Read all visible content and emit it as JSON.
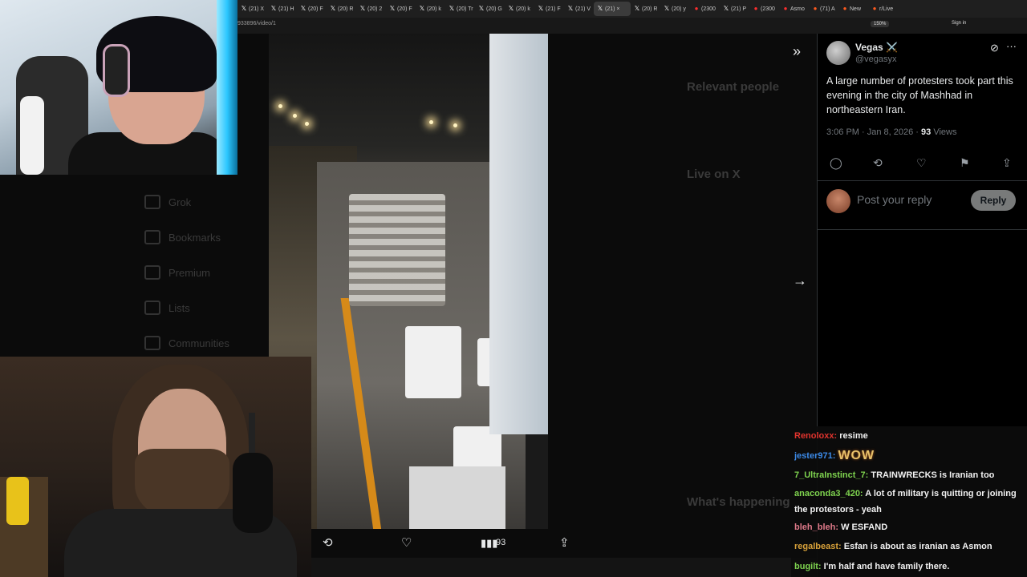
{
  "browser": {
    "tabs": [
      {
        "label": "(21) X",
        "favicon": "X"
      },
      {
        "label": "(21) H",
        "favicon": "X"
      },
      {
        "label": "(20) F",
        "favicon": "X"
      },
      {
        "label": "(20) R",
        "favicon": "X"
      },
      {
        "label": "(20) 2",
        "favicon": "X"
      },
      {
        "label": "(20) F",
        "favicon": "X"
      },
      {
        "label": "(20) k",
        "favicon": "X"
      },
      {
        "label": "(20) Tr",
        "favicon": "X"
      },
      {
        "label": "(20) G",
        "favicon": "X"
      },
      {
        "label": "(20) k",
        "favicon": "X"
      },
      {
        "label": "(21) F",
        "favicon": "X"
      },
      {
        "label": "(21) V",
        "favicon": "X"
      },
      {
        "label": "(21) ×",
        "favicon": "X",
        "active": true
      },
      {
        "label": "(20) R",
        "favicon": "X"
      },
      {
        "label": "(20) y",
        "favicon": "X"
      },
      {
        "label": "(2300",
        "favicon": "yt"
      },
      {
        "label": "(21) P",
        "favicon": "X"
      },
      {
        "label": "(2300",
        "favicon": "yt"
      },
      {
        "label": "Asmo",
        "favicon": "yt"
      },
      {
        "label": "(71) A",
        "favicon": "pi"
      },
      {
        "label": "New",
        "favicon": "rd"
      },
      {
        "label": "r/Live",
        "favicon": "rd"
      }
    ],
    "url": "933896/video/1",
    "zoom": "150%",
    "signin": "Sign in"
  },
  "background_page": {
    "nav": [
      "Grok",
      "Bookmarks",
      "Premium",
      "Lists",
      "Communities"
    ],
    "relevant_title": "Relevant people",
    "live_title": "Live on X",
    "happening_title": "What's happening"
  },
  "media": {
    "views": "93"
  },
  "tweet": {
    "name": "Vegas ⚔️",
    "handle": "@vegasyx",
    "text": "A large number of protesters took part this evening in the city of Mashhad in northeastern Iran.",
    "time": "3:06 PM · Jan 8, 2026 ·",
    "views_count": "93",
    "views_label": "Views",
    "reply_placeholder": "Post your reply",
    "reply_button": "Reply"
  },
  "chat": [
    {
      "user": "Renoloxx:",
      "color": "#e2342e",
      "text": "resime"
    },
    {
      "user": "jester971:",
      "color": "#3c8ae8",
      "text": "",
      "emote": "WOW"
    },
    {
      "user": "7_UltraInstinct_7:",
      "color": "#7fd44f",
      "text": "TRAINWRECKS is Iranian too"
    },
    {
      "user": "anaconda3_420:",
      "color": "#7fd44f",
      "text": "A lot of military is quitting or joining the protestors - yeah"
    },
    {
      "user": "bleh_bleh:",
      "color": "#e07a8a",
      "text": "W ESFAND"
    },
    {
      "user": "regalbeast:",
      "color": "#d9a23a",
      "text": "Esfan is about as iranian as Asmon"
    },
    {
      "user": "bugilt:",
      "color": "#7fd44f",
      "text": "I'm half and have family there."
    }
  ],
  "colors": {
    "page_bg": "#000000",
    "accent_text": "#e7e9ea",
    "muted_text": "#71767b",
    "reply_button_bg": "#787a7a"
  }
}
